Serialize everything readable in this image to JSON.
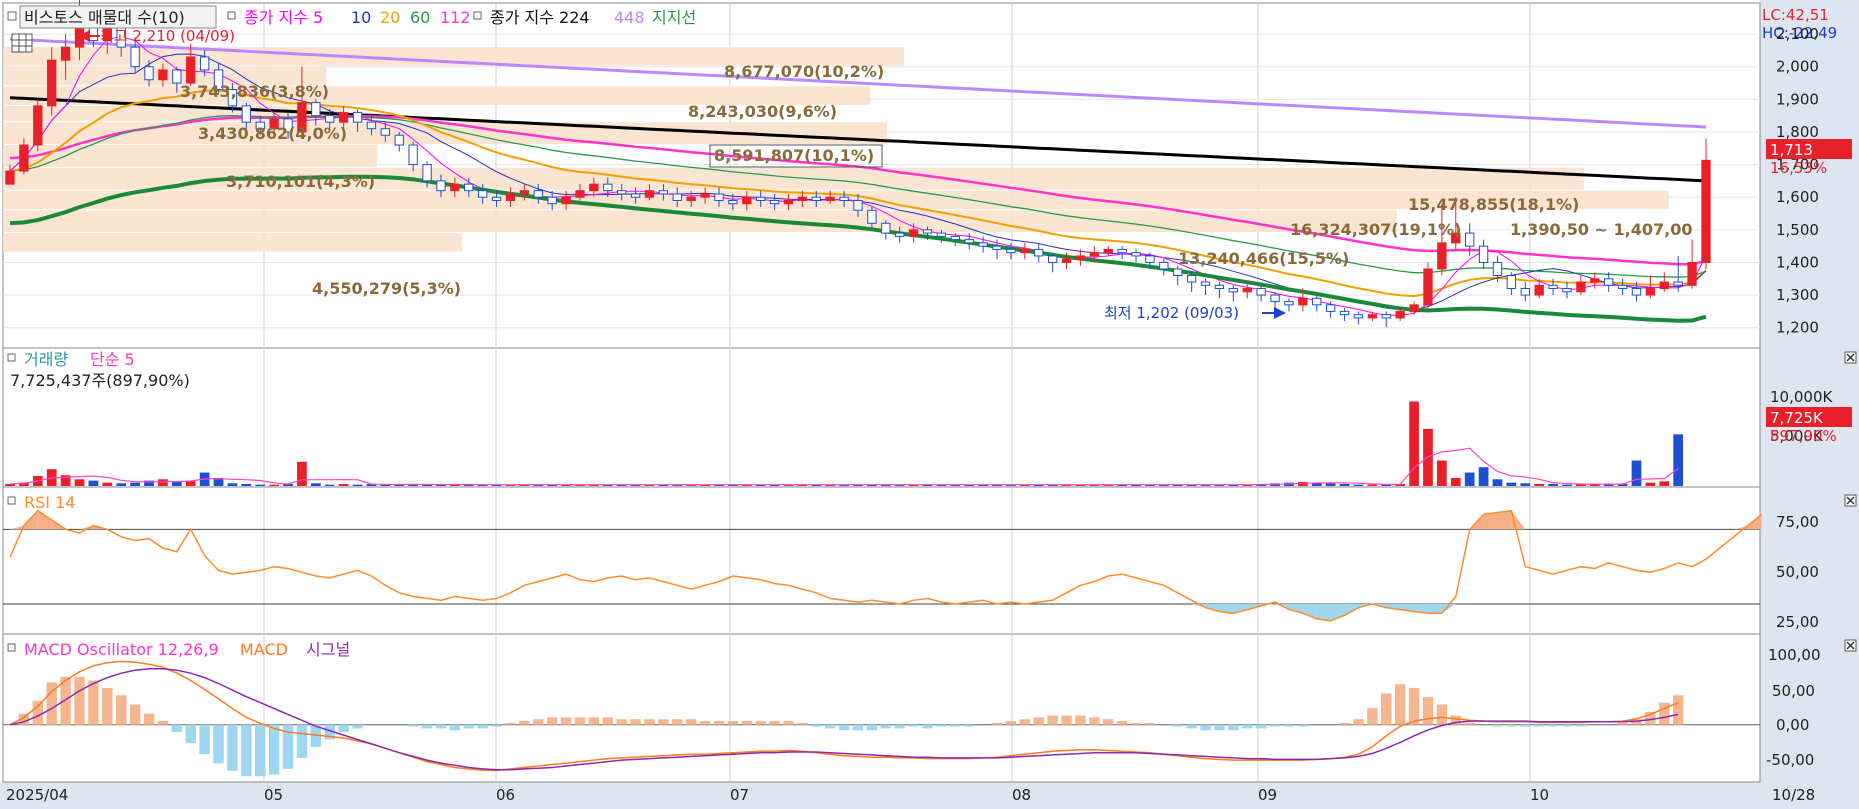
{
  "colors": {
    "up": "#e8202a",
    "down": "#1f4fd1",
    "ma5": "#ff00ff",
    "ma10": "#2233bb",
    "ma20": "#f0a000",
    "ma60": "#2a9a4a",
    "ma112": "#ff33cc",
    "ma224": "#000000",
    "ma448": "#bb88ff",
    "support": "#1a8a3a",
    "band": "#f8e2cc",
    "axisPanel": "#dde6f0",
    "grid": "#d8d8d8",
    "rsi": "#ff8c2a",
    "macd": "#ff7a20",
    "signal": "#8a2ab0",
    "oscUp": "#f5b58f",
    "oscDown": "#9fd6f0",
    "volMa": "#ff44cc"
  },
  "header": {
    "box": "비스토스 매물대 수(10)",
    "closeIdx": "종가 지수 5",
    "p10": "10",
    "p20": "20",
    "p60": "60",
    "p112": "112",
    "closeIdx2": "종가 지수 224",
    "p448": "448",
    "support": "지지선"
  },
  "priceAxis": {
    "lc": "LC:42,51",
    "hc": "HC:-22,49",
    "currentLabel": "1,713",
    "currentPct": "16,53%",
    "ticks": [
      "2,100",
      "2,000",
      "1,900",
      "1,800",
      "1,700",
      "1,600",
      "1,500",
      "1,400",
      "1,300",
      "1,200"
    ]
  },
  "annotations": {
    "high": "최고 2,210 (04/09)",
    "low": "최저 1,202 (09/03)"
  },
  "volumeProfile": [
    "8,677,070(10,2%)",
    "3,743,836(3,8%)",
    "8,243,030(9,6%)",
    "3,430,862(4,0%)",
    "8,591,807(10,1%)",
    "3,710,101(4,3%)",
    "15,478,855(18,1%)",
    "16,324,307(19,1%)",
    "1,390,50 ~ 1,407,00",
    "13,240,466(15,5%)",
    "4,550,279(5,3%)"
  ],
  "volume": {
    "title1": "거래량",
    "title2": "단순 5",
    "info": "7,725,437주(897,90%)",
    "ticks": [
      "10,000K",
      "5,000K"
    ],
    "currentLabel": "7,725K",
    "currentPct": "897,90%"
  },
  "rsi": {
    "title": "RSI 14",
    "ticks": [
      "75,00",
      "50,00",
      "25,00"
    ]
  },
  "macd": {
    "title1": "MACD Oscillator 12,26,9",
    "title2": "MACD",
    "title3": "시그널",
    "ticks": [
      "100,00",
      "50,00",
      "0,00",
      "-50,00"
    ]
  },
  "xAxis": {
    "labels": [
      "2025/04",
      "05",
      "06",
      "07",
      "08",
      "09",
      "10"
    ],
    "end": "10/28"
  },
  "chart_data": {
    "type": "candlestick",
    "title": "비스토스",
    "period": "2025/04 – 2025/10/28",
    "last_close": 1713,
    "last_change_pct": 16.53,
    "high": {
      "value": 2210,
      "date": "04/09"
    },
    "low": {
      "value": 1202,
      "date": "09/03"
    },
    "price_range": [
      1150,
      2180
    ],
    "volume_range": [
      0,
      14000000
    ],
    "rsi_range": [
      15,
      90
    ],
    "macd_range": [
      -75,
      115
    ],
    "last_volume": 7725437,
    "volume_profile_count": 10,
    "rsi_levels": [
      70,
      30
    ],
    "legend": [
      "종가 지수 5",
      "10",
      "20",
      "60",
      "112",
      "종가 지수 224",
      "448",
      "지지선"
    ],
    "months": [
      "2025/04",
      "05",
      "06",
      "07",
      "08",
      "09",
      "10",
      "10/28"
    ],
    "candles": [
      [
        1640,
        1680,
        1650,
        1700
      ],
      [
        1680,
        1760,
        1670,
        1780
      ],
      [
        1760,
        1880,
        1740,
        1900
      ],
      [
        1880,
        2020,
        1850,
        2060
      ],
      [
        2020,
        2060,
        1960,
        2100
      ],
      [
        2060,
        2140,
        2020,
        2210
      ],
      [
        2140,
        2080,
        2060,
        2160
      ],
      [
        2080,
        2120,
        2040,
        2150
      ],
      [
        2120,
        2060,
        2030,
        2140
      ],
      [
        2060,
        2000,
        1980,
        2090
      ],
      [
        2000,
        1960,
        1940,
        2020
      ],
      [
        1960,
        1990,
        1940,
        2010
      ],
      [
        1990,
        1950,
        1920,
        2000
      ],
      [
        1950,
        2030,
        1940,
        2070
      ],
      [
        2030,
        1990,
        1970,
        2050
      ],
      [
        1990,
        1930,
        1920,
        2010
      ],
      [
        1930,
        1880,
        1860,
        1950
      ],
      [
        1880,
        1830,
        1810,
        1890
      ],
      [
        1830,
        1810,
        1790,
        1850
      ],
      [
        1810,
        1840,
        1800,
        1860
      ],
      [
        1840,
        1800,
        1780,
        1860
      ],
      [
        1800,
        1890,
        1780,
        2000
      ],
      [
        1890,
        1850,
        1820,
        1900
      ],
      [
        1850,
        1830,
        1810,
        1870
      ],
      [
        1830,
        1860,
        1810,
        1880
      ],
      [
        1860,
        1830,
        1800,
        1870
      ],
      [
        1830,
        1810,
        1790,
        1850
      ],
      [
        1810,
        1790,
        1770,
        1830
      ],
      [
        1790,
        1760,
        1740,
        1800
      ],
      [
        1760,
        1700,
        1680,
        1770
      ],
      [
        1700,
        1650,
        1630,
        1710
      ],
      [
        1650,
        1620,
        1600,
        1670
      ],
      [
        1620,
        1640,
        1600,
        1660
      ],
      [
        1640,
        1620,
        1600,
        1660
      ],
      [
        1620,
        1600,
        1580,
        1640
      ],
      [
        1600,
        1590,
        1570,
        1620
      ],
      [
        1590,
        1610,
        1570,
        1630
      ],
      [
        1610,
        1620,
        1590,
        1640
      ],
      [
        1620,
        1600,
        1580,
        1640
      ],
      [
        1600,
        1580,
        1560,
        1620
      ],
      [
        1580,
        1600,
        1560,
        1620
      ],
      [
        1600,
        1620,
        1590,
        1640
      ],
      [
        1620,
        1640,
        1600,
        1660
      ],
      [
        1640,
        1620,
        1600,
        1660
      ],
      [
        1620,
        1610,
        1590,
        1640
      ],
      [
        1610,
        1600,
        1580,
        1630
      ],
      [
        1600,
        1620,
        1590,
        1640
      ],
      [
        1620,
        1610,
        1590,
        1640
      ],
      [
        1610,
        1590,
        1570,
        1630
      ],
      [
        1590,
        1600,
        1570,
        1620
      ],
      [
        1600,
        1610,
        1580,
        1630
      ],
      [
        1610,
        1590,
        1570,
        1630
      ],
      [
        1590,
        1580,
        1560,
        1610
      ],
      [
        1580,
        1600,
        1560,
        1620
      ],
      [
        1600,
        1590,
        1570,
        1620
      ],
      [
        1590,
        1580,
        1560,
        1610
      ],
      [
        1580,
        1590,
        1560,
        1610
      ],
      [
        1590,
        1600,
        1570,
        1620
      ],
      [
        1600,
        1590,
        1570,
        1620
      ],
      [
        1590,
        1600,
        1580,
        1620
      ],
      [
        1600,
        1590,
        1570,
        1620
      ],
      [
        1590,
        1560,
        1540,
        1610
      ],
      [
        1560,
        1520,
        1500,
        1570
      ],
      [
        1520,
        1490,
        1470,
        1530
      ],
      [
        1490,
        1480,
        1460,
        1510
      ],
      [
        1480,
        1500,
        1460,
        1520
      ],
      [
        1500,
        1490,
        1470,
        1510
      ],
      [
        1490,
        1480,
        1460,
        1500
      ],
      [
        1480,
        1470,
        1450,
        1490
      ],
      [
        1470,
        1460,
        1440,
        1490
      ],
      [
        1460,
        1450,
        1430,
        1480
      ],
      [
        1450,
        1440,
        1410,
        1470
      ],
      [
        1440,
        1430,
        1410,
        1460
      ],
      [
        1430,
        1440,
        1410,
        1460
      ],
      [
        1440,
        1420,
        1400,
        1460
      ],
      [
        1420,
        1400,
        1370,
        1430
      ],
      [
        1400,
        1410,
        1380,
        1430
      ],
      [
        1410,
        1420,
        1390,
        1440
      ],
      [
        1420,
        1430,
        1400,
        1450
      ],
      [
        1430,
        1440,
        1420,
        1450
      ],
      [
        1440,
        1430,
        1410,
        1450
      ],
      [
        1430,
        1420,
        1400,
        1440
      ],
      [
        1420,
        1400,
        1380,
        1430
      ],
      [
        1400,
        1380,
        1360,
        1410
      ],
      [
        1380,
        1360,
        1330,
        1390
      ],
      [
        1360,
        1340,
        1310,
        1370
      ],
      [
        1340,
        1330,
        1300,
        1350
      ],
      [
        1330,
        1320,
        1290,
        1340
      ],
      [
        1320,
        1310,
        1280,
        1330
      ],
      [
        1310,
        1320,
        1290,
        1340
      ],
      [
        1320,
        1300,
        1280,
        1330
      ],
      [
        1300,
        1280,
        1260,
        1310
      ],
      [
        1280,
        1270,
        1250,
        1290
      ],
      [
        1270,
        1290,
        1250,
        1320
      ],
      [
        1290,
        1270,
        1250,
        1300
      ],
      [
        1270,
        1250,
        1230,
        1280
      ],
      [
        1250,
        1240,
        1220,
        1260
      ],
      [
        1240,
        1230,
        1210,
        1250
      ],
      [
        1230,
        1240,
        1220,
        1250
      ],
      [
        1240,
        1230,
        1202,
        1250
      ],
      [
        1230,
        1250,
        1220,
        1260
      ],
      [
        1250,
        1270,
        1240,
        1280
      ],
      [
        1270,
        1380,
        1260,
        1400
      ],
      [
        1380,
        1460,
        1360,
        1580
      ],
      [
        1460,
        1490,
        1440,
        1600
      ],
      [
        1490,
        1450,
        1420,
        1520
      ],
      [
        1450,
        1400,
        1380,
        1470
      ],
      [
        1400,
        1360,
        1340,
        1420
      ],
      [
        1360,
        1320,
        1300,
        1370
      ],
      [
        1320,
        1300,
        1280,
        1340
      ],
      [
        1300,
        1330,
        1290,
        1350
      ],
      [
        1330,
        1320,
        1300,
        1350
      ],
      [
        1320,
        1310,
        1290,
        1340
      ],
      [
        1310,
        1340,
        1300,
        1360
      ],
      [
        1340,
        1350,
        1320,
        1370
      ],
      [
        1350,
        1330,
        1310,
        1370
      ],
      [
        1330,
        1320,
        1300,
        1350
      ],
      [
        1320,
        1300,
        1280,
        1340
      ],
      [
        1300,
        1320,
        1290,
        1360
      ],
      [
        1320,
        1340,
        1310,
        1370
      ],
      [
        1340,
        1330,
        1310,
        1420
      ],
      [
        1330,
        1400,
        1320,
        1470
      ],
      [
        1400,
        1713,
        1380,
        1780
      ]
    ],
    "volume_mil": [
      0.3,
      0.5,
      1.5,
      2.5,
      1.6,
      1.0,
      0.8,
      0.5,
      0.4,
      0.5,
      0.8,
      1.0,
      0.6,
      0.8,
      2.0,
      1.2,
      0.4,
      0.3,
      0.2,
      0.2,
      0.3,
      3.6,
      0.4,
      0.2,
      0.3,
      0.2,
      0.3,
      0.2,
      0.2,
      0.3,
      0.2,
      0.2,
      0.2,
      0.2,
      0.2,
      0.2,
      0.2,
      0.2,
      0.2,
      0.2,
      0.2,
      0.2,
      0.2,
      0.2,
      0.2,
      0.2,
      0.2,
      0.2,
      0.2,
      0.2,
      0.2,
      0.2,
      0.2,
      0.2,
      0.2,
      0.2,
      0.2,
      0.2,
      0.2,
      0.2,
      0.2,
      0.2,
      0.2,
      0.2,
      0.2,
      0.2,
      0.2,
      0.2,
      0.2,
      0.2,
      0.2,
      0.2,
      0.2,
      0.2,
      0.2,
      0.2,
      0.2,
      0.2,
      0.2,
      0.2,
      0.2,
      0.2,
      0.2,
      0.2,
      0.2,
      0.2,
      0.2,
      0.2,
      0.2,
      0.2,
      0.3,
      0.4,
      0.5,
      0.6,
      0.5,
      0.4,
      0.3,
      0.2,
      0.2,
      0.2,
      0.3,
      12.6,
      8.5,
      3.8,
      1.2,
      2.0,
      2.8,
      1.0,
      0.5,
      0.4,
      0.3,
      0.3,
      0.2,
      0.3,
      0.3,
      0.3,
      0.3,
      3.8,
      0.5,
      0.7,
      7.7
    ],
    "rsi": [
      55,
      72,
      80,
      75,
      70,
      68,
      72,
      70,
      66,
      64,
      65,
      60,
      58,
      70,
      56,
      48,
      46,
      47,
      48,
      50,
      49,
      47,
      45,
      44,
      46,
      48,
      45,
      40,
      36,
      34,
      33,
      32,
      34,
      33,
      32,
      33,
      36,
      40,
      42,
      44,
      46,
      43,
      42,
      44,
      45,
      43,
      44,
      42,
      40,
      38,
      40,
      42,
      45,
      44,
      43,
      41,
      40,
      38,
      36,
      33,
      32,
      31,
      32,
      31,
      30,
      32,
      33,
      31,
      30,
      31,
      32,
      30,
      31,
      30,
      31,
      32,
      36,
      40,
      42,
      45,
      46,
      44,
      42,
      40,
      36,
      32,
      28,
      26,
      25,
      27,
      29,
      31,
      27,
      25,
      22,
      21,
      24,
      28,
      30,
      28,
      27,
      26,
      25,
      25,
      34,
      70,
      78,
      79,
      80,
      50,
      48,
      46,
      48,
      50,
      49,
      52,
      50,
      48,
      47,
      49,
      52,
      50,
      54,
      60,
      66,
      72,
      78
    ],
    "macd": [
      0,
      10,
      25,
      45,
      60,
      72,
      80,
      84,
      86,
      85,
      82,
      78,
      70,
      60,
      48,
      35,
      22,
      10,
      2,
      -5,
      -10,
      -12,
      -14,
      -16,
      -18,
      -22,
      -26,
      -32,
      -38,
      -44,
      -50,
      -54,
      -58,
      -60,
      -62,
      -62,
      -60,
      -58,
      -56,
      -54,
      -52,
      -50,
      -48,
      -46,
      -45,
      -44,
      -43,
      -42,
      -41,
      -40,
      -40,
      -39,
      -38,
      -37,
      -36,
      -36,
      -35,
      -36,
      -38,
      -40,
      -42,
      -43,
      -44,
      -44,
      -45,
      -45,
      -46,
      -46,
      -46,
      -46,
      -45,
      -44,
      -42,
      -40,
      -38,
      -36,
      -35,
      -34,
      -34,
      -35,
      -36,
      -37,
      -38,
      -40,
      -42,
      -44,
      -46,
      -47,
      -48,
      -48,
      -48,
      -48,
      -48,
      -48,
      -47,
      -46,
      -44,
      -40,
      -30,
      -15,
      -2,
      5,
      8,
      10,
      8,
      6,
      5,
      4,
      4,
      4,
      3,
      3,
      3,
      3,
      4,
      4,
      5,
      8,
      14,
      22,
      30
    ],
    "signal": [
      0,
      4,
      12,
      22,
      34,
      46,
      56,
      64,
      70,
      74,
      76,
      76,
      74,
      70,
      64,
      56,
      47,
      38,
      30,
      22,
      14,
      6,
      -2,
      -8,
      -14,
      -20,
      -26,
      -32,
      -38,
      -43,
      -48,
      -52,
      -55,
      -58,
      -60,
      -61,
      -61,
      -60,
      -59,
      -58,
      -56,
      -54,
      -52,
      -50,
      -48,
      -47,
      -46,
      -45,
      -44,
      -43,
      -42,
      -41,
      -40,
      -39,
      -38,
      -38,
      -37,
      -37,
      -37,
      -38,
      -39,
      -40,
      -41,
      -42,
      -43,
      -44,
      -44,
      -45,
      -45,
      -45,
      -45,
      -45,
      -44,
      -43,
      -42,
      -41,
      -40,
      -39,
      -38,
      -38,
      -38,
      -38,
      -39,
      -40,
      -41,
      -42,
      -43,
      -44,
      -45,
      -46,
      -46,
      -47,
      -47,
      -47,
      -47,
      -46,
      -45,
      -43,
      -39,
      -32,
      -24,
      -15,
      -7,
      -1,
      3,
      5,
      5,
      5,
      5,
      5,
      4,
      4,
      4,
      4,
      4,
      4,
      4,
      5,
      7,
      10,
      14
    ]
  }
}
